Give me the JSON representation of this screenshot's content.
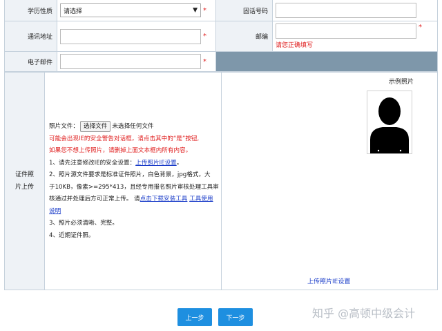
{
  "form": {
    "education_label": "学历性质",
    "education_value": "请选择",
    "phone_label": "固话号码",
    "address_label": "通讯地址",
    "zip_label": "邮编",
    "zip_hint": "请您正确填写",
    "email_label": "电子邮件",
    "required_mark": "*"
  },
  "photo": {
    "label_line1": "证件照",
    "label_line2": "片上传",
    "file_label": "照片文件：",
    "choose_btn": "选择文件",
    "no_file": "未选择任何文件",
    "warn1": "可能会出现IE的安全警告对话框，请点击其中的“是”按钮,",
    "warn2": "如果您不想上传照片，请删掉上面文本框内所有内容。",
    "item1_text": "1、请先注意修改IE的安全设置：",
    "item1_link": "上传照片IE设置",
    "item1_end": "。",
    "item2_a": "2、照片源文件要求是标准证件照片，白色背景，jpg格式，大",
    "item2_b": "于10KB，像素>=295*413，且经专用报名照片审核处理工具审",
    "item2_c": "核通过并处理后方可正常上传。 请",
    "item2_link1": "点击下载安装工具",
    "item2_sep": " ",
    "item2_link2a": "工具使用",
    "item2_link2b": "说明",
    "item3": "3、照片必须清晰、完整。",
    "item4": "4、近期证件照。",
    "sample_title": "示例照片",
    "sample_link": "上传照片IE设置"
  },
  "buttons": {
    "prev": "上一步",
    "next": "下一步"
  },
  "watermark": "知乎 @高顿中级会计"
}
